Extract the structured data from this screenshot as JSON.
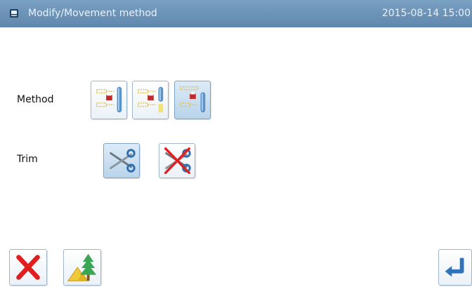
{
  "header": {
    "title": "Modify/Movement method",
    "datetime": "2015-08-14 15:00",
    "icon": "document-icon"
  },
  "labels": {
    "method": "Method",
    "trim": "Trim"
  },
  "method_options": [
    {
      "icon": "method-standard-icon",
      "selected": false
    },
    {
      "icon": "method-with-point-icon",
      "selected": false
    },
    {
      "icon": "method-alternate-icon",
      "selected": true
    }
  ],
  "trim_options": [
    {
      "icon": "scissors-icon",
      "selected": true
    },
    {
      "icon": "no-trim-icon",
      "selected": false
    }
  ],
  "footer": {
    "cancel_icon": "cancel-x-icon",
    "tree_icon": "tree-mountain-icon",
    "enter_icon": "enter-icon"
  },
  "colors": {
    "titlebar": "#5f87ad",
    "accent_red": "#e02020",
    "button_border": "#9fb6cc"
  }
}
